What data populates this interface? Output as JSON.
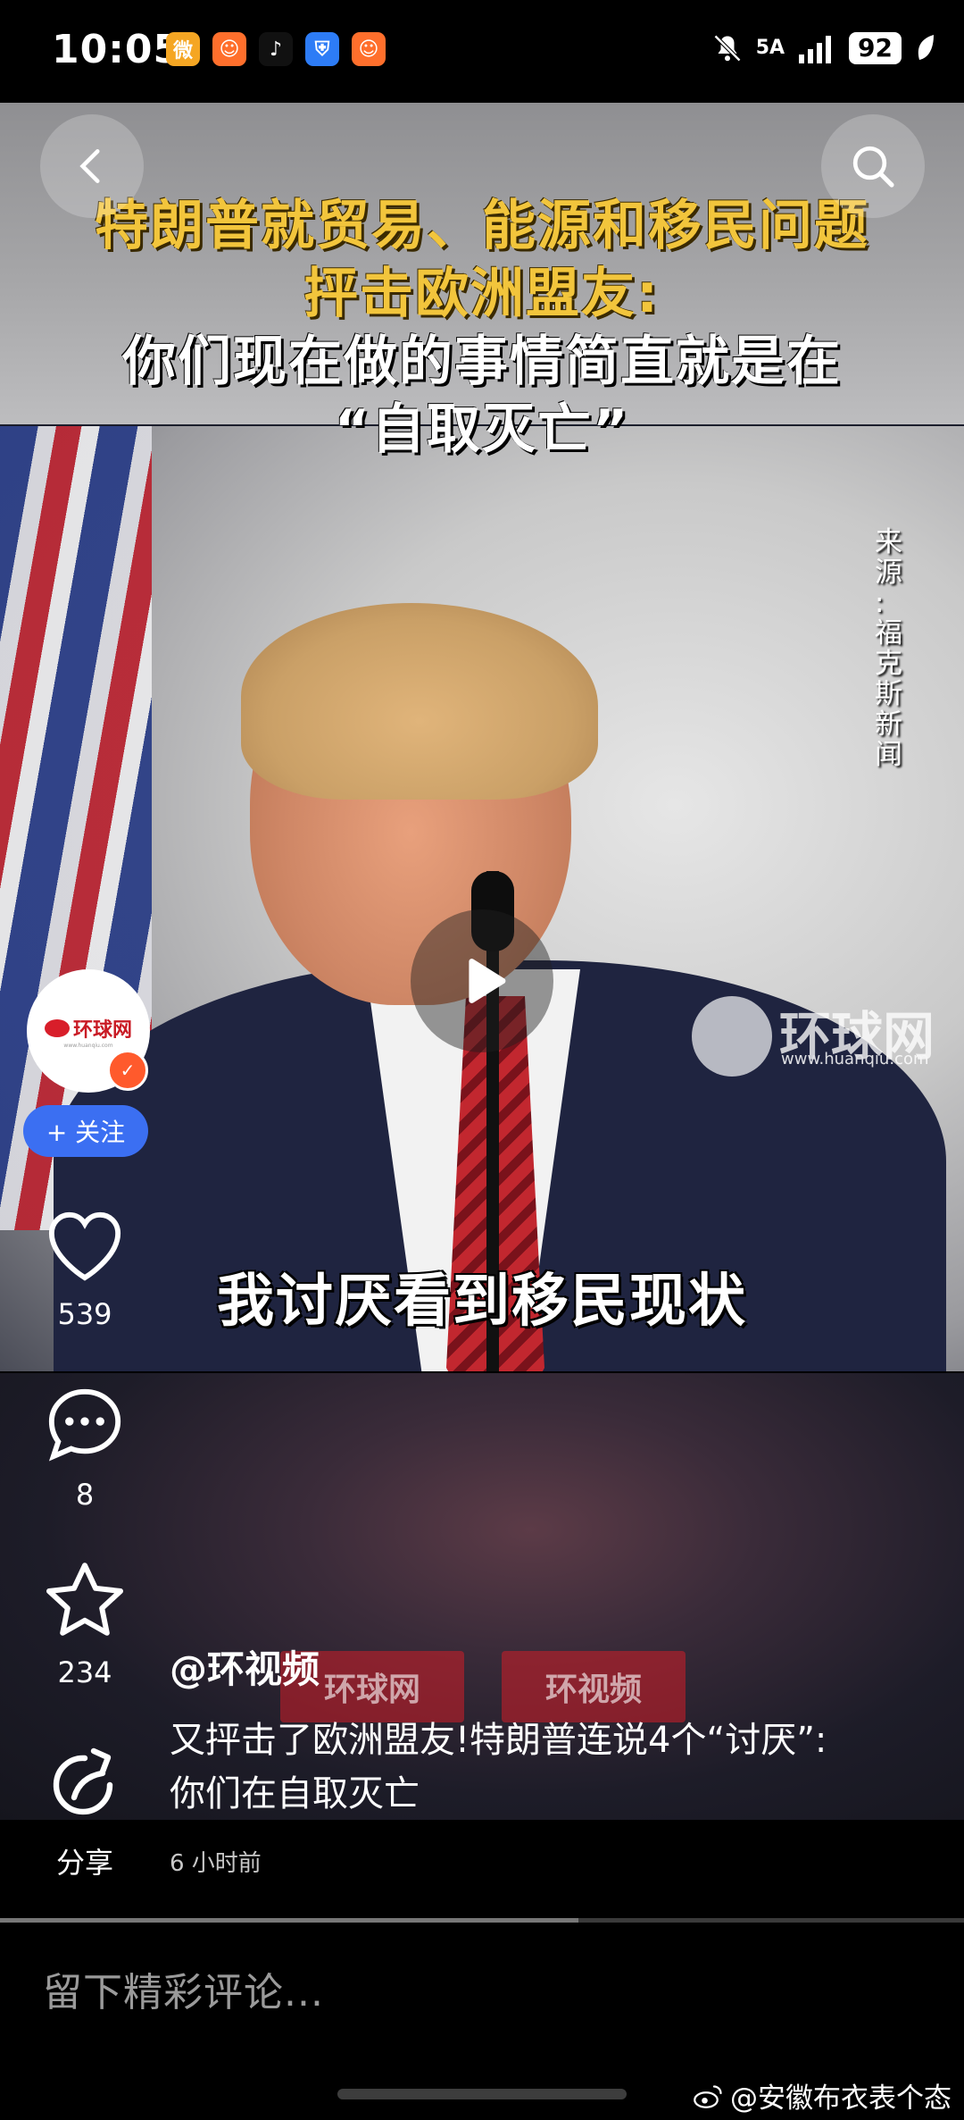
{
  "status_bar": {
    "time": "10:05",
    "app_icons": [
      {
        "name": "weibo-icon",
        "color": "#f5a623",
        "glyph": "微"
      },
      {
        "name": "xiaohongshu-icon",
        "color": "#ff6f2c",
        "glyph": "☺"
      },
      {
        "name": "tiktok-icon",
        "color": "#111111",
        "glyph": "♪"
      },
      {
        "name": "shield-app-icon",
        "color": "#2d7cf6",
        "glyph": "⛨"
      },
      {
        "name": "kuaishou-icon",
        "color": "#ff6f2c",
        "glyph": "☺"
      }
    ],
    "network": "5A",
    "battery": "92"
  },
  "video": {
    "title_line1": "特朗普就贸易、能源和移民问题",
    "title_line2": "抨击欧洲盟友:",
    "title_line3": "你们现在做的事情简直就是在",
    "title_line4": "“自取灭亡”",
    "source": "来源:福克斯新闻",
    "caption": "我讨厌看到移民现状",
    "watermark_text": "环球网",
    "watermark_url": "www.huanqiu.com"
  },
  "actions": {
    "avatar_text": "环球网",
    "avatar_sub": "www.huanqiu.com",
    "follow_label": "+ 关注",
    "like_count": "539",
    "comment_count": "8",
    "favorite_count": "234",
    "share_label": "分享"
  },
  "post": {
    "author": "@环视频",
    "text": "又抨击了欧洲盟友!特朗普连说4个“讨厌”:你们在自取灭亡",
    "time": "6 小时前",
    "overlay_left": "环球网",
    "overlay_right": "环视频"
  },
  "progress": {
    "played_fraction": 0.6
  },
  "comment": {
    "placeholder": "留下精彩评论..."
  },
  "credit": "@安徽布衣表个态"
}
